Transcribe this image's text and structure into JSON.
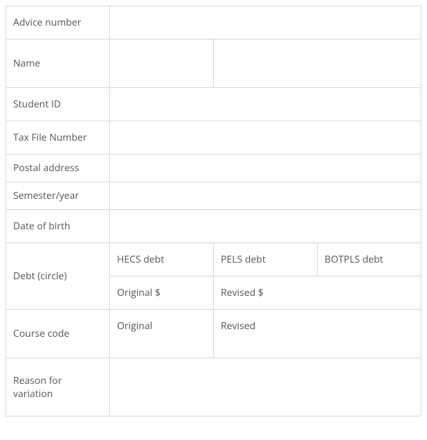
{
  "rows": {
    "advice_number": {
      "label": "Advice number"
    },
    "name": {
      "label": "Name"
    },
    "student_id": {
      "label": "Student ID"
    },
    "tfn": {
      "label": "Tax File Number"
    },
    "postal_address": {
      "label": "Postal address"
    },
    "semester_year": {
      "label": "Semester/year"
    },
    "dob": {
      "label": "Date of birth"
    },
    "debt": {
      "label": "Debt (circle)",
      "hecs": "HECS debt",
      "pels": "PELS debt",
      "botpls": "BOTPLS debt",
      "original_amount": "Original $",
      "revised_amount": "Revised $"
    },
    "course_code": {
      "label": "Course code",
      "original": "Original",
      "revised": "Revised"
    },
    "reason": {
      "label": "Reason for variation"
    }
  }
}
